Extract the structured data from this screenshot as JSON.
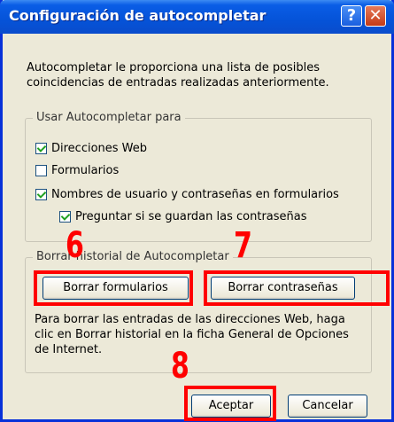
{
  "window": {
    "title": "Configuración de autocompletar",
    "help_glyph": "?",
    "close_glyph": "✕"
  },
  "intro_text": "Autocompletar le proporciona una lista de posibles coincidencias de entradas realizadas anteriormente.",
  "use_group": {
    "legend": "Usar Autocompletar para",
    "options": [
      {
        "label": "Direcciones Web",
        "checked": true
      },
      {
        "label": "Formularios",
        "checked": false
      },
      {
        "label": "Nombres de usuario y contraseñas en formularios",
        "checked": true
      },
      {
        "label": "Preguntar si se guardan las contraseñas",
        "checked": true
      }
    ]
  },
  "history_group": {
    "legend": "Borrar historial de Autocompletar",
    "clear_forms_label": "Borrar formularios",
    "clear_passwords_label": "Borrar contraseñas",
    "note": "Para borrar las entradas de las direcciones Web, haga clic en Borrar historial en la ficha General de Opciones de Internet."
  },
  "footer": {
    "ok_label": "Aceptar",
    "cancel_label": "Cancelar"
  },
  "annotations": {
    "marker_6": "6",
    "marker_7": "7",
    "marker_8": "8",
    "color": "#ff0000"
  }
}
